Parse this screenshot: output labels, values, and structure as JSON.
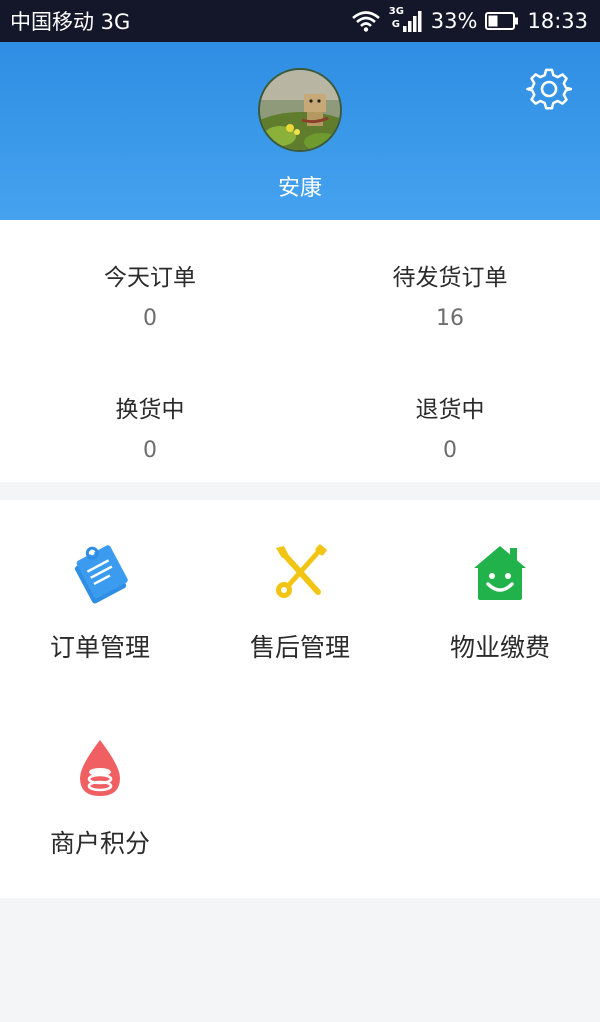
{
  "status_bar": {
    "carrier": "中国移动 3G",
    "network": "3G",
    "network_sub": "G",
    "battery": "33%",
    "time": "18:33",
    "icons": [
      "wifi-icon",
      "signal-icon",
      "battery-icon"
    ]
  },
  "profile": {
    "name": "安康",
    "settings_icon": "gear-icon"
  },
  "stats": [
    {
      "label": "今天订单",
      "value": "0"
    },
    {
      "label": "待发货订单",
      "value": "16"
    },
    {
      "label": "换货中",
      "value": "0"
    },
    {
      "label": "退货中",
      "value": "0"
    }
  ],
  "menu": [
    {
      "label": "订单管理",
      "icon": "order-clipboard-icon",
      "color": "#2f8ee3"
    },
    {
      "label": "售后管理",
      "icon": "tools-icon",
      "color": "#f2c515"
    },
    {
      "label": "物业缴费",
      "icon": "smiling-house-icon",
      "color": "#22b24c"
    },
    {
      "label": "商户积分",
      "icon": "coin-drop-icon",
      "color": "#f06062"
    }
  ],
  "colors": {
    "header_top": "#2f8ee3",
    "header_bottom": "#45a2ef",
    "status_bar": "#14162a"
  }
}
